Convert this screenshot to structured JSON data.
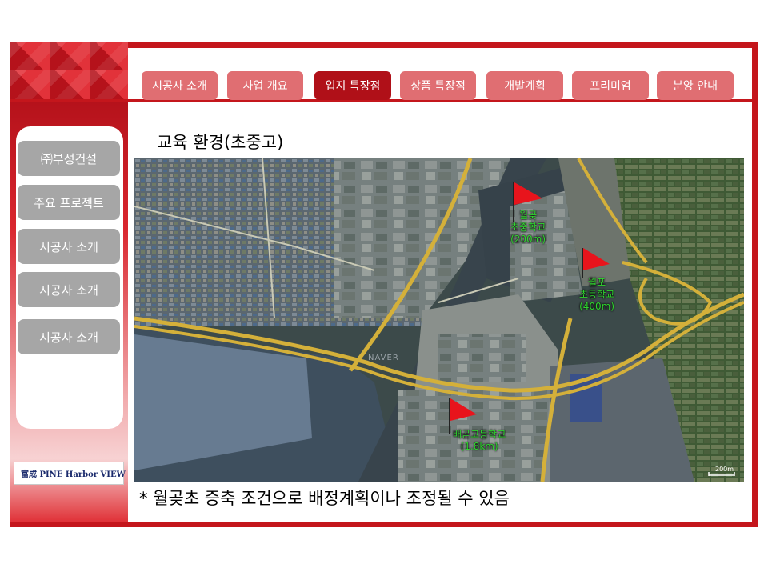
{
  "nav": {
    "tabs": [
      {
        "label": "시공사 소개"
      },
      {
        "label": "사업 개요"
      },
      {
        "label": "입지 특장점",
        "active": true
      },
      {
        "label": "상품 특장점"
      },
      {
        "label": "개발계획"
      },
      {
        "label": "프리미엄"
      },
      {
        "label": "분양 안내"
      }
    ]
  },
  "sidebar": {
    "items": [
      {
        "label": "㈜부성건설"
      },
      {
        "label": "주요 프로젝트"
      },
      {
        "label": "시공사 소개"
      },
      {
        "label": "시공사 소개"
      },
      {
        "label": "시공사 소개"
      }
    ]
  },
  "logo": {
    "text": "富成 PINE Harbor VIEW"
  },
  "main": {
    "title": "교육 환경(초중고)",
    "footnote": "* 월곶초 증축 조건으로 배정계획이나 조정될 수 있음"
  },
  "map": {
    "markers": [
      {
        "name": "월곶",
        "line2": "초중학교",
        "distance": "(200m)"
      },
      {
        "name": "월포",
        "line2": "초등학교",
        "distance": "(400m)"
      },
      {
        "name": "배곧고등학교",
        "distance": "(1.8km)"
      }
    ],
    "watermark": "NAVER",
    "scale": "200m"
  },
  "colors": {
    "frame": "#c4161c",
    "tab": "#e06e72",
    "tab_active": "#b01018",
    "sidebar_button": "#a6a6a6",
    "flag": "#e8141c",
    "school_label": "#2fd62f"
  }
}
